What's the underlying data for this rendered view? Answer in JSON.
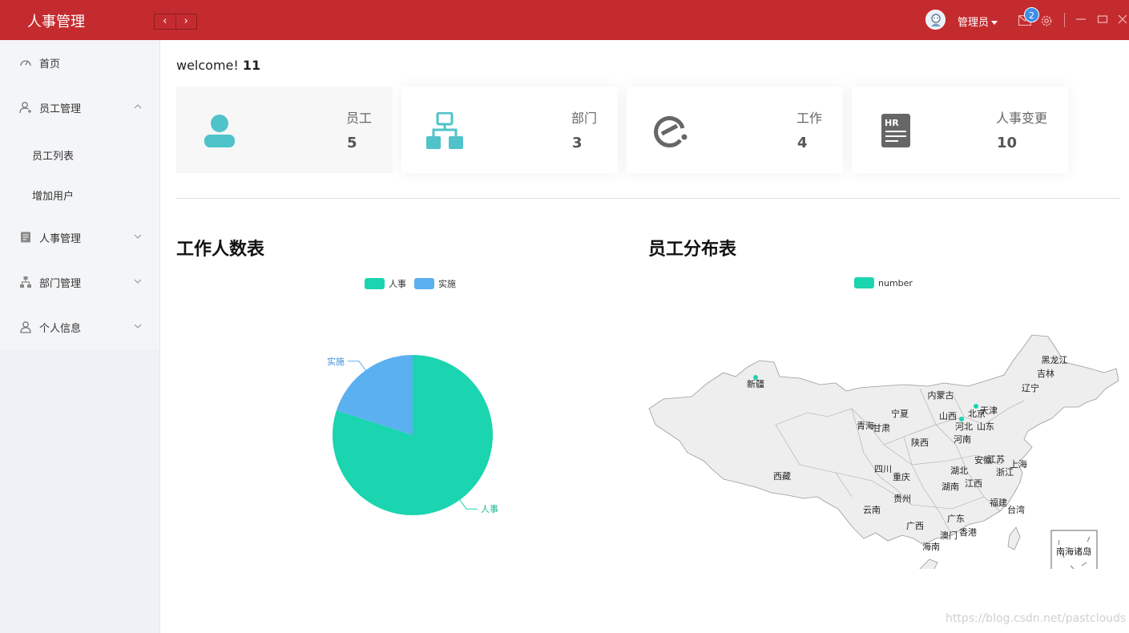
{
  "header": {
    "title": "人事管理",
    "user_name": "管理员",
    "notification_count": "2",
    "bg_color": "#c42b2f"
  },
  "sidebar": {
    "items": [
      {
        "label": "首页",
        "icon": "dashboard-icon"
      },
      {
        "label": "员工管理",
        "icon": "user-add-icon",
        "expanded": true,
        "children": [
          {
            "label": "员工列表"
          },
          {
            "label": "增加用户"
          }
        ]
      },
      {
        "label": "人事管理",
        "icon": "document-icon"
      },
      {
        "label": "部门管理",
        "icon": "org-chart-icon"
      },
      {
        "label": "个人信息",
        "icon": "user-icon"
      }
    ]
  },
  "main": {
    "welcome_prefix": "welcome!",
    "welcome_user": "11",
    "cards": [
      {
        "label": "员工",
        "value": "5",
        "icon": "person-icon",
        "color": "#4fc3c9"
      },
      {
        "label": "部门",
        "value": "3",
        "icon": "org-icon",
        "color": "#4fc3c9"
      },
      {
        "label": "工作",
        "value": "4",
        "icon": "e-logo-icon",
        "color": "#666666"
      },
      {
        "label": "人事变更",
        "value": "10",
        "icon": "hr-icon",
        "color": "#666666"
      }
    ],
    "chart_titles": {
      "pie": "工作人数表",
      "map": "员工分布表"
    }
  },
  "chart_data": [
    {
      "type": "pie",
      "title": "工作人数表",
      "categories": [
        "人事",
        "实施"
      ],
      "values": [
        4,
        1
      ],
      "colors": [
        "#1bd4b0",
        "#5bb0f0"
      ],
      "legend": "top-center"
    },
    {
      "type": "map",
      "title": "员工分布表",
      "legend": [
        "number"
      ],
      "colors": [
        "#1bd4b0"
      ],
      "provinces": [
        "黑龙江",
        "吉林",
        "辽宁",
        "内蒙古",
        "北京",
        "天津",
        "河北",
        "山西",
        "山东",
        "宁夏",
        "青海",
        "甘肃",
        "陕西",
        "河南",
        "新疆",
        "西藏",
        "四川",
        "重庆",
        "湖北",
        "安徽",
        "江苏",
        "上海",
        "浙江",
        "湖南",
        "江西",
        "贵州",
        "云南",
        "福建",
        "台湾",
        "广东",
        "广西",
        "澳门",
        "香港",
        "海南",
        "南海诸岛"
      ],
      "points": [
        "新疆",
        "北京",
        "山西"
      ]
    }
  ],
  "watermark": "https://blog.csdn.net/pastclouds"
}
